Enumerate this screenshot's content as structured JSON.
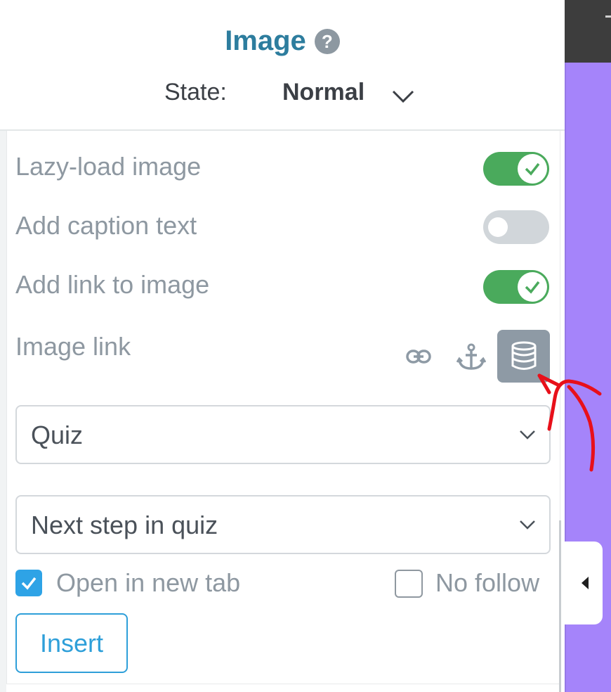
{
  "header": {
    "title": "Image",
    "help_icon": "?",
    "state_label": "State:",
    "state_value": "Normal"
  },
  "settings": {
    "lazy_load": {
      "label": "Lazy-load image",
      "enabled": true
    },
    "caption": {
      "label": "Add caption text",
      "enabled": false
    },
    "add_link": {
      "label": "Add link to image",
      "enabled": true
    },
    "image_link_label": "Image link"
  },
  "link_sources": [
    "link-icon",
    "anchor-icon",
    "database-icon"
  ],
  "selects": {
    "source": {
      "value": "Quiz"
    },
    "target": {
      "value": "Next step in quiz"
    }
  },
  "options": {
    "open_new_tab": {
      "label": "Open in new tab",
      "checked": true
    },
    "no_follow": {
      "label": "No follow",
      "checked": false
    }
  },
  "insert_label": "Insert",
  "colors": {
    "title": "#2d7d9e",
    "toggle_on": "#4aaa5c",
    "toggle_off": "#d1d6da",
    "active_source_bg": "#8e9aa5",
    "checkbox": "#2ea3e6",
    "insert": "#2e9fd9",
    "sidebar_purple": "#a584fa",
    "annotation": "#e8101a"
  }
}
